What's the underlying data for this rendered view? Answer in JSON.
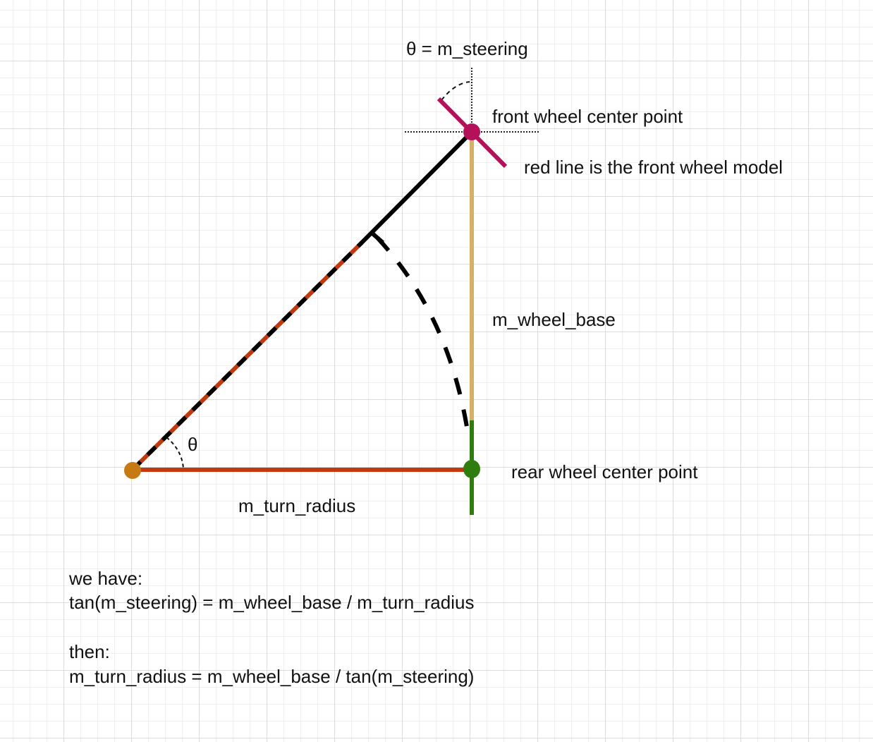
{
  "labels": {
    "steering": "θ = m_steering",
    "front_wheel_center": "front wheel center point",
    "front_wheel_model": "red line is the front wheel model",
    "wheel_base": "m_wheel_base",
    "theta": "θ",
    "rear_wheel_center": "rear wheel center point",
    "turn_radius": "m_turn_radius"
  },
  "text_block": {
    "line1": "we have:",
    "line2": "tan(m_steering) = m_wheel_base / m_turn_radius",
    "line3": "then:",
    "line4": "m_turn_radius = m_wheel_base / tan(m_steering)"
  },
  "colors": {
    "turn_radius_line": "#c0390f",
    "wheel_base_line": "#d4b265",
    "front_wheel": "#b5105a",
    "rear_wheel": "#2e7d0e",
    "pivot_point": "#c77a14",
    "hypotenuse": "#000000"
  }
}
